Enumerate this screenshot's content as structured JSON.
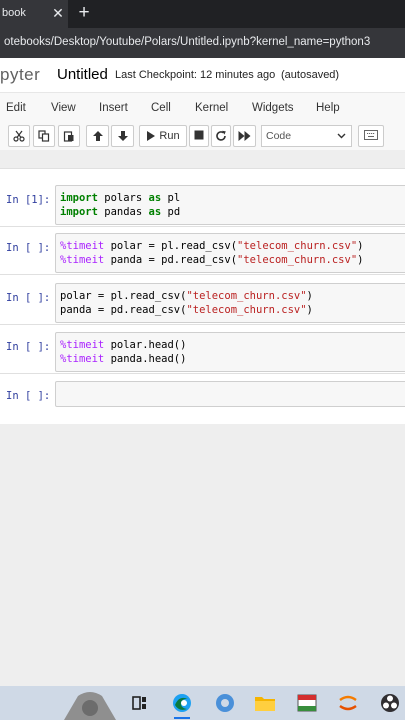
{
  "browser": {
    "tab_title": "book",
    "url": "otebooks/Desktop/Youtube/Polars/Untitled.ipynb?kernel_name=python3"
  },
  "jupyter": {
    "logo_text": "pyter",
    "notebook_title": "Untitled",
    "checkpoint": "Last Checkpoint: 12 minutes ago",
    "autosave_status": "(autosaved)"
  },
  "menu": [
    "Edit",
    "View",
    "Insert",
    "Cell",
    "Kernel",
    "Widgets",
    "Help"
  ],
  "toolbar": {
    "run_label": "Run",
    "cell_type": "Code",
    "icons": [
      "cut-icon",
      "copy-icon",
      "paste-icon",
      "arrow-up-icon",
      "arrow-down-icon",
      "play-icon",
      "stop-icon",
      "restart-icon",
      "fast-forward-icon",
      "keyboard-icon"
    ]
  },
  "cells": [
    {
      "prompt": "In [1]:",
      "lines": [
        "import polars as pl",
        "import pandas as pd"
      ]
    },
    {
      "prompt": "In [ ]:",
      "lines": [
        "%timeit polar = pl.read_csv(\"telecom_churn.csv\")",
        "%timeit panda = pd.read_csv(\"telecom_churn.csv\")"
      ]
    },
    {
      "prompt": "In [ ]:",
      "lines": [
        "polar = pl.read_csv(\"telecom_churn.csv\")",
        "panda = pd.read_csv(\"telecom_churn.csv\")"
      ]
    },
    {
      "prompt": "In [ ]:",
      "lines": [
        "%timeit polar.head()",
        "%timeit panda.head()"
      ]
    },
    {
      "prompt": "In [ ]:",
      "lines": [
        ""
      ]
    }
  ],
  "taskbar": {
    "icons": [
      "task-view-icon",
      "edge-icon",
      "file-explorer-icon",
      "app-icon",
      "tool-icon",
      "obs-icon"
    ]
  },
  "colors": {
    "browser_chrome": "#35363a",
    "prompt_blue": "#303f9f",
    "keyword_green": "#008000",
    "string_red": "#ba2121",
    "magic_purple": "#aa22ff",
    "taskbar": "#cfd9e6"
  }
}
